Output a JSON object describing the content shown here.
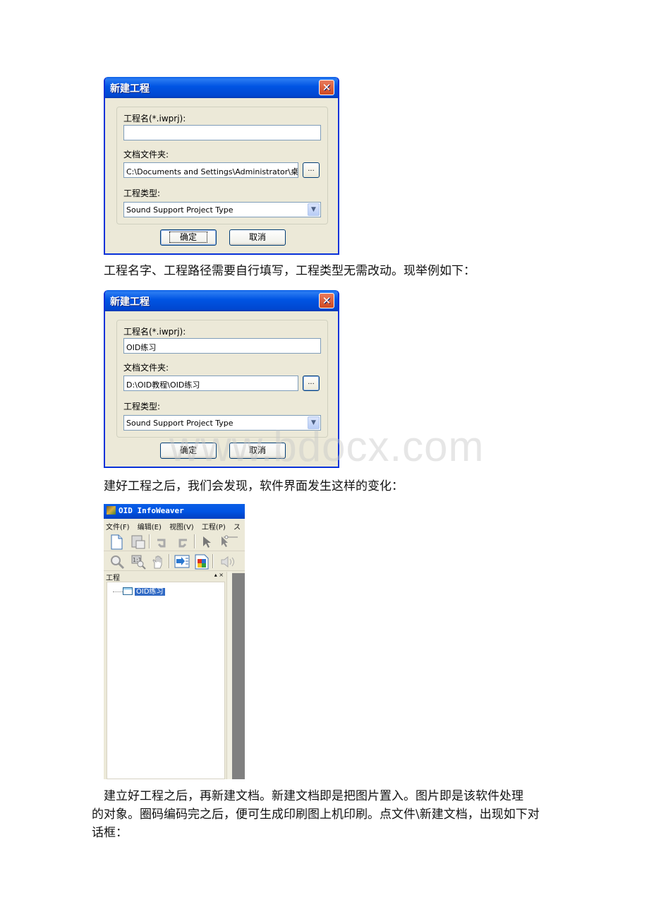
{
  "dialog_empty": {
    "title": "新建工程",
    "project_name_label": "工程名(*.iwprj):",
    "project_name_value": "",
    "folder_label": "文档文件夹:",
    "folder_value": "C:\\Documents and Settings\\Administrator\\桌面",
    "browse_label": "...",
    "type_label": "工程类型:",
    "type_value": "Sound Support Project Type",
    "ok_label": "确定",
    "cancel_label": "取消"
  },
  "paragraph_1": "工程名字、工程路径需要自行填写，工程类型无需改动。现举例如下：",
  "dialog_filled": {
    "title": "新建工程",
    "project_name_label": "工程名(*.iwprj):",
    "project_name_value": "OID练习",
    "folder_label": "文档文件夹:",
    "folder_value": "D:\\OID教程\\OID练习",
    "browse_label": "...",
    "type_label": "工程类型:",
    "type_value": "Sound Support Project Type",
    "ok_label": "确定",
    "cancel_label": "取消"
  },
  "watermark": "www.bdocx.com",
  "paragraph_2": "建好工程之后，我们会发现，软件界面发生这样的变化：",
  "app": {
    "title": "OID InfoWeaver",
    "menu": [
      "文件(F)",
      "编辑(E)",
      "视图(V)",
      "工程(P)",
      "ス"
    ],
    "toolbar1": [
      "new-document-icon",
      "save-icon",
      "undo-icon",
      "redo-icon",
      "pointer-icon",
      "add-point-icon"
    ],
    "toolbar2": [
      "zoom-icon",
      "zoom-actual-icon",
      "hand-icon",
      "import-icon",
      "color-icon",
      "sound-icon"
    ],
    "panel_title": "工程",
    "panel_controls": "▴ ×",
    "tree_node": "OID练习"
  },
  "paragraph_3": {
    "line1": "建立好工程之后，再新建文档。新建文档即是把图片置入。图片即是该软件处理",
    "line2": "的对象。圈码编码完之后，便可生成印刷图上机印刷。点文件\\新建文档，出现如下对",
    "line3": "话框："
  }
}
